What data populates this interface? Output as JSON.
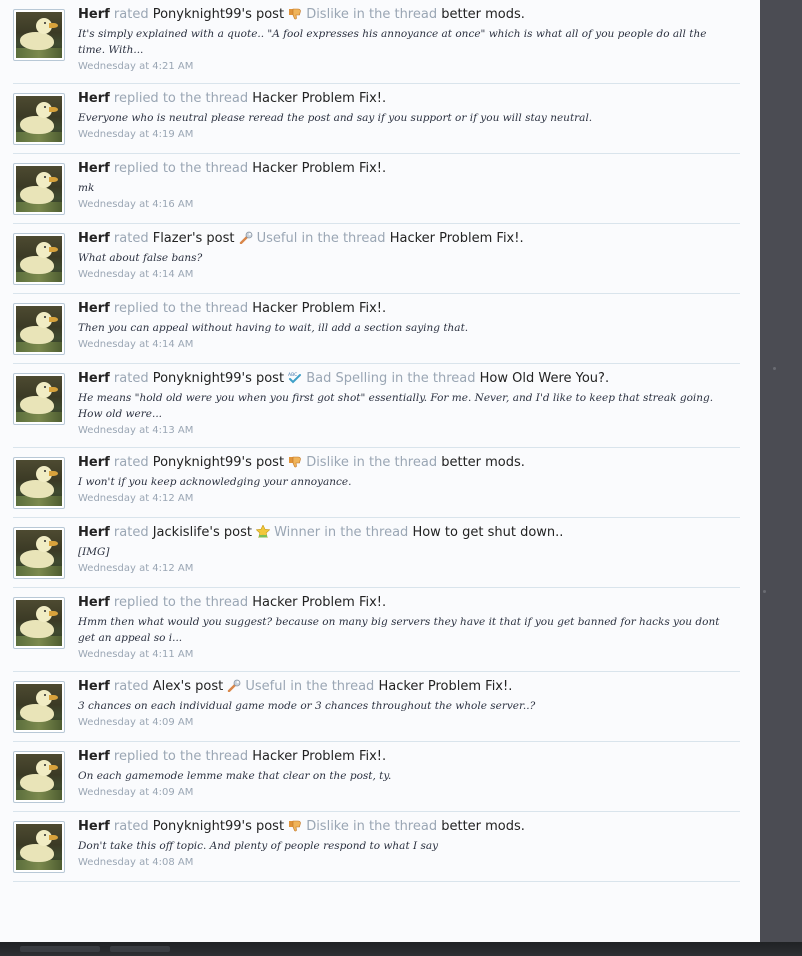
{
  "feed": [
    {
      "user": "Herf",
      "action": "rated",
      "post_owner": "Ponyknight99's post",
      "rating_icon": "dislike-icon",
      "rating": "Dislike",
      "in_thread": "in the thread",
      "thread": "better mods.",
      "snippet": "It's simply explained with a quote.. \"A fool expresses his annoyance at once\" which is what all of you people do all the time. With...",
      "time": "Wednesday at 4:21 AM"
    },
    {
      "user": "Herf",
      "action": "replied to the thread",
      "thread": "Hacker Problem Fix!.",
      "snippet": "Everyone who is neutral please reread the post and say if you support or if you will stay neutral.",
      "time": "Wednesday at 4:19 AM"
    },
    {
      "user": "Herf",
      "action": "replied to the thread",
      "thread": "Hacker Problem Fix!.",
      "snippet": "mk",
      "time": "Wednesday at 4:16 AM"
    },
    {
      "user": "Herf",
      "action": "rated",
      "post_owner": "Flazer's post",
      "rating_icon": "wrench-icon",
      "rating": "Useful",
      "in_thread": "in the thread",
      "thread": "Hacker Problem Fix!.",
      "snippet": "What about false bans?",
      "time": "Wednesday at 4:14 AM"
    },
    {
      "user": "Herf",
      "action": "replied to the thread",
      "thread": "Hacker Problem Fix!.",
      "snippet": "Then you can appeal without having to wait, ill add a section saying that.",
      "time": "Wednesday at 4:14 AM"
    },
    {
      "user": "Herf",
      "action": "rated",
      "post_owner": "Ponyknight99's post",
      "rating_icon": "spelling-icon",
      "rating": "Bad Spelling",
      "in_thread": "in the thread",
      "thread": "How Old Were You?.",
      "snippet": "He means \"hold old were you when you first got shot\" essentially. For me. Never, and I'd like to keep that streak going. How old were...",
      "time": "Wednesday at 4:13 AM"
    },
    {
      "user": "Herf",
      "action": "rated",
      "post_owner": "Ponyknight99's post",
      "rating_icon": "dislike-icon",
      "rating": "Dislike",
      "in_thread": "in the thread",
      "thread": "better mods.",
      "snippet": "I won't if you keep acknowledging your annoyance.",
      "time": "Wednesday at 4:12 AM"
    },
    {
      "user": "Herf",
      "action": "rated",
      "post_owner": "Jackislife's post",
      "rating_icon": "winner-icon",
      "rating": "Winner",
      "in_thread": "in the thread",
      "thread": "How to get shut down..",
      "snippet": "[IMG]",
      "time": "Wednesday at 4:12 AM"
    },
    {
      "user": "Herf",
      "action": "replied to the thread",
      "thread": "Hacker Problem Fix!.",
      "snippet": "Hmm then what would you suggest? because on many big servers they have it that if you get banned for hacks you dont get an appeal so i...",
      "time": "Wednesday at 4:11 AM"
    },
    {
      "user": "Herf",
      "action": "rated",
      "post_owner": "Alex's post",
      "rating_icon": "wrench-icon",
      "rating": "Useful",
      "in_thread": "in the thread",
      "thread": "Hacker Problem Fix!.",
      "snippet": "3 chances on each individual game mode or 3 chances throughout the whole server..?",
      "time": "Wednesday at 4:09 AM"
    },
    {
      "user": "Herf",
      "action": "replied to the thread",
      "thread": "Hacker Problem Fix!.",
      "snippet": "On each gamemode lemme make that clear on the post, ty.",
      "time": "Wednesday at 4:09 AM"
    },
    {
      "user": "Herf",
      "action": "rated",
      "post_owner": "Ponyknight99's post",
      "rating_icon": "dislike-icon",
      "rating": "Dislike",
      "in_thread": "in the thread",
      "thread": "better mods.",
      "snippet": "Don't take this off topic. And plenty of people respond to what I say",
      "time": "Wednesday at 4:08 AM"
    }
  ],
  "colors": {
    "page_bg": "#fafbfd",
    "muted_text": "#9aa6b4",
    "link_text": "#222222",
    "divider": "#d9e4ec",
    "side_panel": "#4b4c53"
  }
}
